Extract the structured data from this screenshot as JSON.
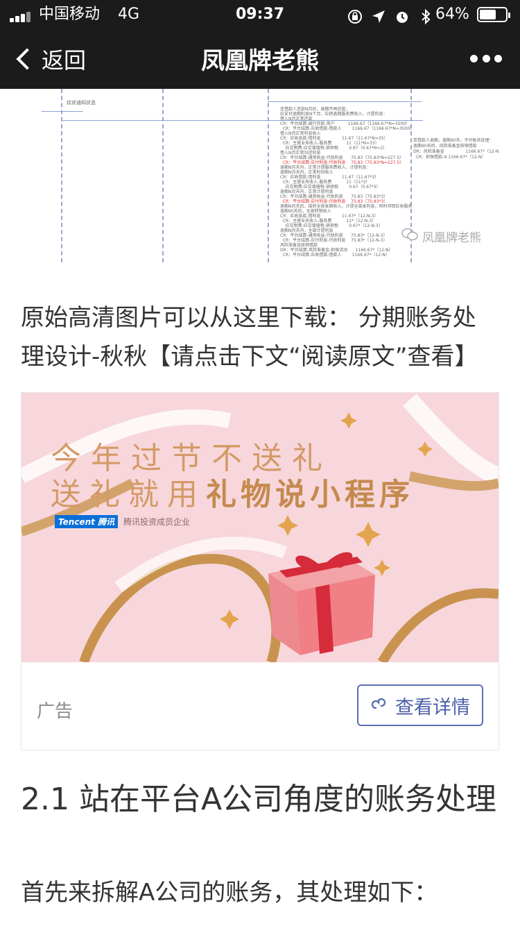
{
  "status": {
    "carrier": "中国移动",
    "network": "4G",
    "time": "09:37",
    "battery_pct": "64%",
    "battery_level": 0.64
  },
  "nav": {
    "back_label": "返回",
    "title": "凤凰牌老熊"
  },
  "diagram": {
    "caption_left": "纹状通知状态",
    "watermark": "凤凰牌老熊",
    "lines": [
      "还借款人还款N月后，逾期不再还款，",
      "应支付逾期利息N个月，应把逾期服务费收入，计提利息：",
      "借入N月正常还款",
      "CR：平台结算-银行存款-用户          1166.67（1166.67*N=3500）",
      "  CR：平台结算-应收借款-借款人        1166.67（1166.67*N=3500）",
      "借入N月正常利息收入",
      "CR：应收息款-借利息                11.67（11.67*N=35）",
      "  CR：主营业务收入-服务费           11（11*N=33）",
      "    应交税费-应交增值税-销项税        0.67（0.67*N=2）",
      "借入N月正常归还利息",
      "CR：平台结算-通用收益-代收利息      75.83（75.83*N=227.5）",
      "  CR：平台结算-应付利息-代收利息    75.83（75.83*N=227.5）",
      "逾期N月天内，正常计提服务费收入，计提利息：",
      "逾期N月天内，正常时间收入",
      "CR：应收借款-借利息                11.67（11.67*3）",
      "  CR：主营业务收入-服务费           11（11*3）",
      "    应交税费-应交增值税-销项税        0.67（0.67*3）",
      "逾期N月天内，正常计提利息",
      "CR：平台结算-通用收益-代收利息      75.83（75.83*3）",
      "  CR：平台结算-应付利息-代收利息    75.83（75.83*3）",
      "逾期N月天后，结转全部本期收入，计提全部本利息，同时冲回应收服务",
      "逾期90天后，全部转销收入",
      "CR：应收息款-借利息                11.67*（12-N-3）",
      "  CR：主营业务收入-服务费           11*（12-N-3）",
      "    应交税费-应交增值税-销项税        0.67*（12-N-3）",
      "逾期N月天内，全部计提利息",
      "CR：平台结算-通用收益-代收利息      75.83*（12-N-3）",
      "  CR：平台结算-应付利息-代收利息    75.83*（12-N-3）",
      "风险准备金核销借款",
      "DR：平台结算-风险准备金-担保活动      1166.67*（12-N）",
      "  CR：平台结算-应收借款-借款人        1166.67*（12-N）"
    ],
    "right_lines": [
      "若借款人逾期，逾期90天，不付账务处理：",
      "逾期90天后，风险准备金核销借款",
      "DR：风险准备金                1166.67*（12-N）",
      "  CR：担保借款-A 1166.67*（12-N）"
    ]
  },
  "paragraph": "原始高清图片可以从这里下载： 分期账务处理设计-秋秋【请点击下文“阅读原文”查看】",
  "ad": {
    "line1": "今年过节不送礼",
    "line2_prefix": "送礼就用",
    "line2_bold": "礼物说小程序",
    "logo": "Tencent 腾讯",
    "logo_sub": "腾讯投资成员企业",
    "label": "广告",
    "button": "查看详情",
    "colors": {
      "banner": "#f7d7dc",
      "button": "#4a5fa8"
    }
  },
  "heading": "2.1 站在平台A公司角度的账务处理",
  "body_text": "首先来拆解A公司的账务，其处理如下："
}
